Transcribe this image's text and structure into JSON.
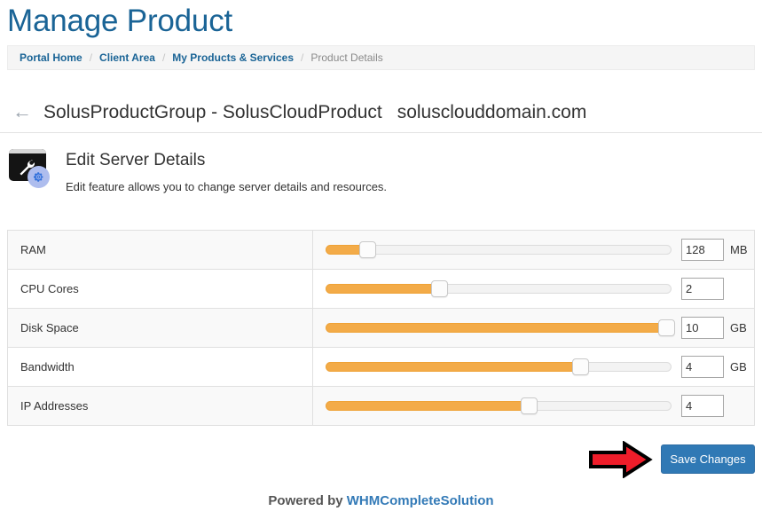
{
  "header": {
    "title": "Manage Product"
  },
  "breadcrumb": {
    "separator": "/",
    "items": [
      {
        "label": "Portal Home",
        "current": false
      },
      {
        "label": "Client Area",
        "current": false
      },
      {
        "label": "My Products & Services",
        "current": false
      },
      {
        "label": "Product Details",
        "current": true
      }
    ]
  },
  "product": {
    "back_icon": "arrow-left-icon",
    "name": "SolusProductGroup - SolusCloudProduct",
    "domain": "solusclouddomain.com"
  },
  "feature": {
    "icon": "server-wrench-gear-icon",
    "title": "Edit Server Details",
    "description": "Edit feature allows you to change server details and resources."
  },
  "resources": [
    {
      "label": "RAM",
      "value": "128",
      "unit": "MB",
      "percent": 12,
      "slider_name": "ram-slider",
      "input_name": "ram-value-input"
    },
    {
      "label": "CPU Cores",
      "value": "2",
      "unit": "",
      "percent": 33,
      "slider_name": "cpu-cores-slider",
      "input_name": "cpu-cores-value-input"
    },
    {
      "label": "Disk Space",
      "value": "10",
      "unit": "GB",
      "percent": 99,
      "slider_name": "disk-space-slider",
      "input_name": "disk-space-value-input"
    },
    {
      "label": "Bandwidth",
      "value": "4",
      "unit": "GB",
      "percent": 74,
      "slider_name": "bandwidth-slider",
      "input_name": "bandwidth-value-input"
    },
    {
      "label": "IP Addresses",
      "value": "4",
      "unit": "",
      "percent": 59,
      "slider_name": "ip-addresses-slider",
      "input_name": "ip-addresses-value-input"
    }
  ],
  "actions": {
    "save_label": "Save Changes",
    "annotation_arrow": "red-arrow-annotation"
  },
  "footer": {
    "powered_prefix": "Powered by ",
    "brand": "WHMCompleteSolution"
  },
  "colors": {
    "title_blue": "#1a6496",
    "link_blue": "#337ab7",
    "slider_orange": "#f3ab48",
    "button_blue": "#3079b5",
    "annotation_red": "#ef1d2a"
  }
}
